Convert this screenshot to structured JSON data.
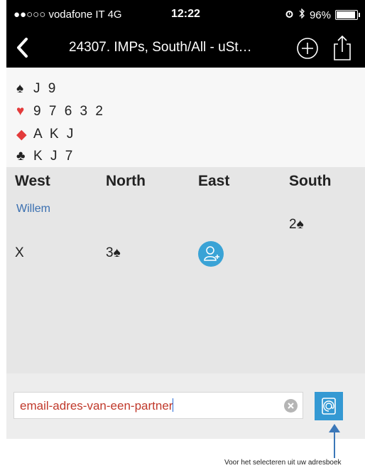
{
  "status_bar": {
    "carrier": "●●○○○ vodafone IT  4G",
    "time": "12:22",
    "battery": "96%",
    "icons": [
      "alarm-icon",
      "bluetooth-icon",
      "battery-icon"
    ]
  },
  "nav": {
    "title": "24307. IMPs, South/All - uSt…",
    "icons": [
      "back-chevron-icon",
      "add-circle-icon",
      "share-icon"
    ]
  },
  "hand": [
    {
      "suit": "♠",
      "suit_name": "spades",
      "color": "#222222",
      "cards": "J 9"
    },
    {
      "suit": "♥",
      "suit_name": "hearts",
      "color": "#e33b3b",
      "cards": "9 7 6 3 2"
    },
    {
      "suit": "◆",
      "suit_name": "diamonds",
      "color": "#e33b3b",
      "cards": "A K J"
    },
    {
      "suit": "♣",
      "suit_name": "clubs",
      "color": "#222222",
      "cards": "K J 7"
    }
  ],
  "bidding": {
    "headers": {
      "west": "West",
      "north": "North",
      "east": "East",
      "south": "South"
    },
    "player_west": "Willem",
    "bids": {
      "south_1": "2♠",
      "west_2": "X",
      "north_2": "3♠"
    }
  },
  "input": {
    "email_value": "email-adres-van-een-partner",
    "icons": [
      "clear-icon",
      "address-book-icon"
    ]
  },
  "annotation": {
    "text": "Voor het selecteren uit uw adresboek"
  },
  "colors": {
    "accent": "#3499d3",
    "link": "#3a6fb0",
    "email_text": "#c0392b",
    "red_suit": "#e33b3b",
    "arrow": "#3b77b8"
  }
}
